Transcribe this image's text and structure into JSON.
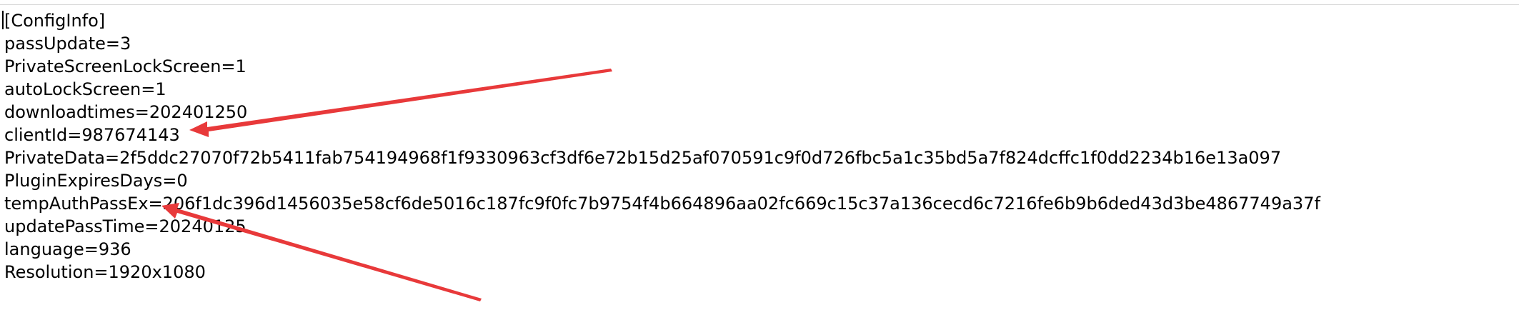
{
  "editor": {
    "lines": [
      "[ConfigInfo]",
      "passUpdate=3",
      "PrivateScreenLockScreen=1",
      "autoLockScreen=1",
      "downloadtimes=202401250",
      "clientId=987674143",
      "PrivateData=2f5ddc27070f72b5411fab754194968f1f9330963cf3df6e72b15d25af070591c9f0d726fbc5a1c35bd5a7f824dcffc1f0dd2234b16e13a097",
      "PluginExpiresDays=0",
      "tempAuthPassEx=206f1dc396d1456035e58cf6de5016c187fc9f0fc7b9754f4b664896aa02fc669c15c37a136cecd6c7216fe6b9b6ded43d3be4867749a37f",
      "updatePassTime=20240125",
      "language=936",
      "Resolution=1920x1080"
    ]
  },
  "annotations": {
    "arrow_color": "#e8393a"
  }
}
